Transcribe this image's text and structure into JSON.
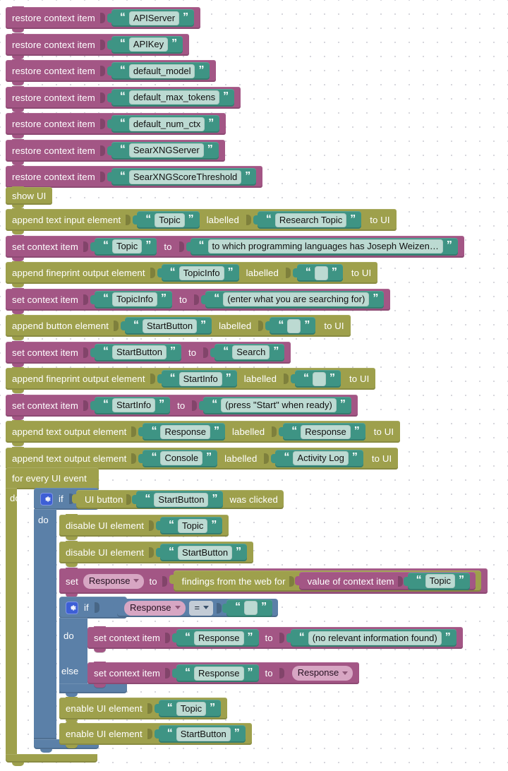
{
  "workspace": {
    "background": "#ffffff",
    "grid_color": "#c8c8d0",
    "colors": {
      "context_block": "#a35685",
      "ui_block": "#9ea04c",
      "logic_block": "#5b80a8",
      "string_block": "#3e9484",
      "field_pill": "#bcdad2",
      "variable_dropdown": "#d7a6c3",
      "operator_dropdown": "#c3ccd6",
      "gear_icon": "#3d5fd6"
    },
    "quote_open": "“",
    "quote_close": "”"
  },
  "restore_blocks": [
    {
      "verb": "restore context item",
      "value": "APIServer"
    },
    {
      "verb": "restore context item",
      "value": "APIKey"
    },
    {
      "verb": "restore context item",
      "value": "default_model"
    },
    {
      "verb": "restore context item",
      "value": "default_max_tokens"
    },
    {
      "verb": "restore context item",
      "value": "default_num_ctx"
    },
    {
      "verb": "restore context item",
      "value": "SearXNGServer"
    },
    {
      "verb": "restore context item",
      "value": "SearXNGScoreThreshold"
    }
  ],
  "show_ui": {
    "label": "show UI"
  },
  "setup_blocks": [
    {
      "kind": "append",
      "verb": "append text input element",
      "name": "Topic",
      "mid_label": "labelled",
      "label_value": "Research Topic",
      "tail": "to UI"
    },
    {
      "kind": "set",
      "verb": "set context item",
      "name": "Topic",
      "mid_label": "to",
      "label_value": "to which programming languages has Joseph Weizen…"
    },
    {
      "kind": "append",
      "verb": "append fineprint output element",
      "name": "TopicInfo",
      "mid_label": "labelled",
      "label_value": "",
      "tail": "to UI"
    },
    {
      "kind": "set",
      "verb": "set context item",
      "name": "TopicInfo",
      "mid_label": "to",
      "label_value": "(enter what you are searching for)"
    },
    {
      "kind": "append",
      "verb": "append button element",
      "name": "StartButton",
      "mid_label": "labelled",
      "label_value": "",
      "tail": "to UI"
    },
    {
      "kind": "set",
      "verb": "set context item",
      "name": "StartButton",
      "mid_label": "to",
      "label_value": "Search"
    },
    {
      "kind": "append",
      "verb": "append fineprint output element",
      "name": "StartInfo",
      "mid_label": "labelled",
      "label_value": "",
      "tail": "to UI"
    },
    {
      "kind": "set",
      "verb": "set context item",
      "name": "StartInfo",
      "mid_label": "to",
      "label_value": "(press \"Start\" when ready)"
    },
    {
      "kind": "append",
      "verb": "append text output element",
      "name": "Response",
      "mid_label": "labelled",
      "label_value": "Response",
      "tail": "to UI"
    },
    {
      "kind": "append",
      "verb": "append text output element",
      "name": "Console",
      "mid_label": "labelled",
      "label_value": "Activity Log",
      "tail": "to UI"
    }
  ],
  "event_loop": {
    "header": "for every UI event",
    "do_label": "do",
    "outer_if": {
      "if_label": "if",
      "condition": {
        "prefix": "UI button",
        "value": "StartButton",
        "suffix": "was clicked"
      },
      "do_label": "do",
      "body": [
        {
          "kind": "stmt_olive",
          "verb": "disable UI element",
          "value": "Topic"
        },
        {
          "kind": "stmt_olive",
          "verb": "disable UI element",
          "value": "StartButton"
        },
        {
          "kind": "set_var",
          "verb": "set",
          "variable": "Response",
          "mid_label": "to",
          "expr_label": "findings from the web for",
          "inner_verb": "value of context item",
          "inner_value": "Topic"
        }
      ],
      "inner_if": {
        "if_label": "if",
        "condition": {
          "left_variable": "Response",
          "operator": "=",
          "right_value": ""
        },
        "do_label": "do",
        "do_body": [
          {
            "kind": "set",
            "verb": "set context item",
            "name": "Response",
            "mid_label": "to",
            "label_value": "(no relevant information found)"
          }
        ],
        "else_label": "else",
        "else_body": [
          {
            "kind": "set_to_var",
            "verb": "set context item",
            "name": "Response",
            "mid_label": "to",
            "variable": "Response"
          }
        ]
      },
      "tail_body": [
        {
          "kind": "stmt_olive",
          "verb": "enable UI element",
          "value": "Topic"
        },
        {
          "kind": "stmt_olive",
          "verb": "enable UI element",
          "value": "StartButton"
        }
      ]
    }
  }
}
